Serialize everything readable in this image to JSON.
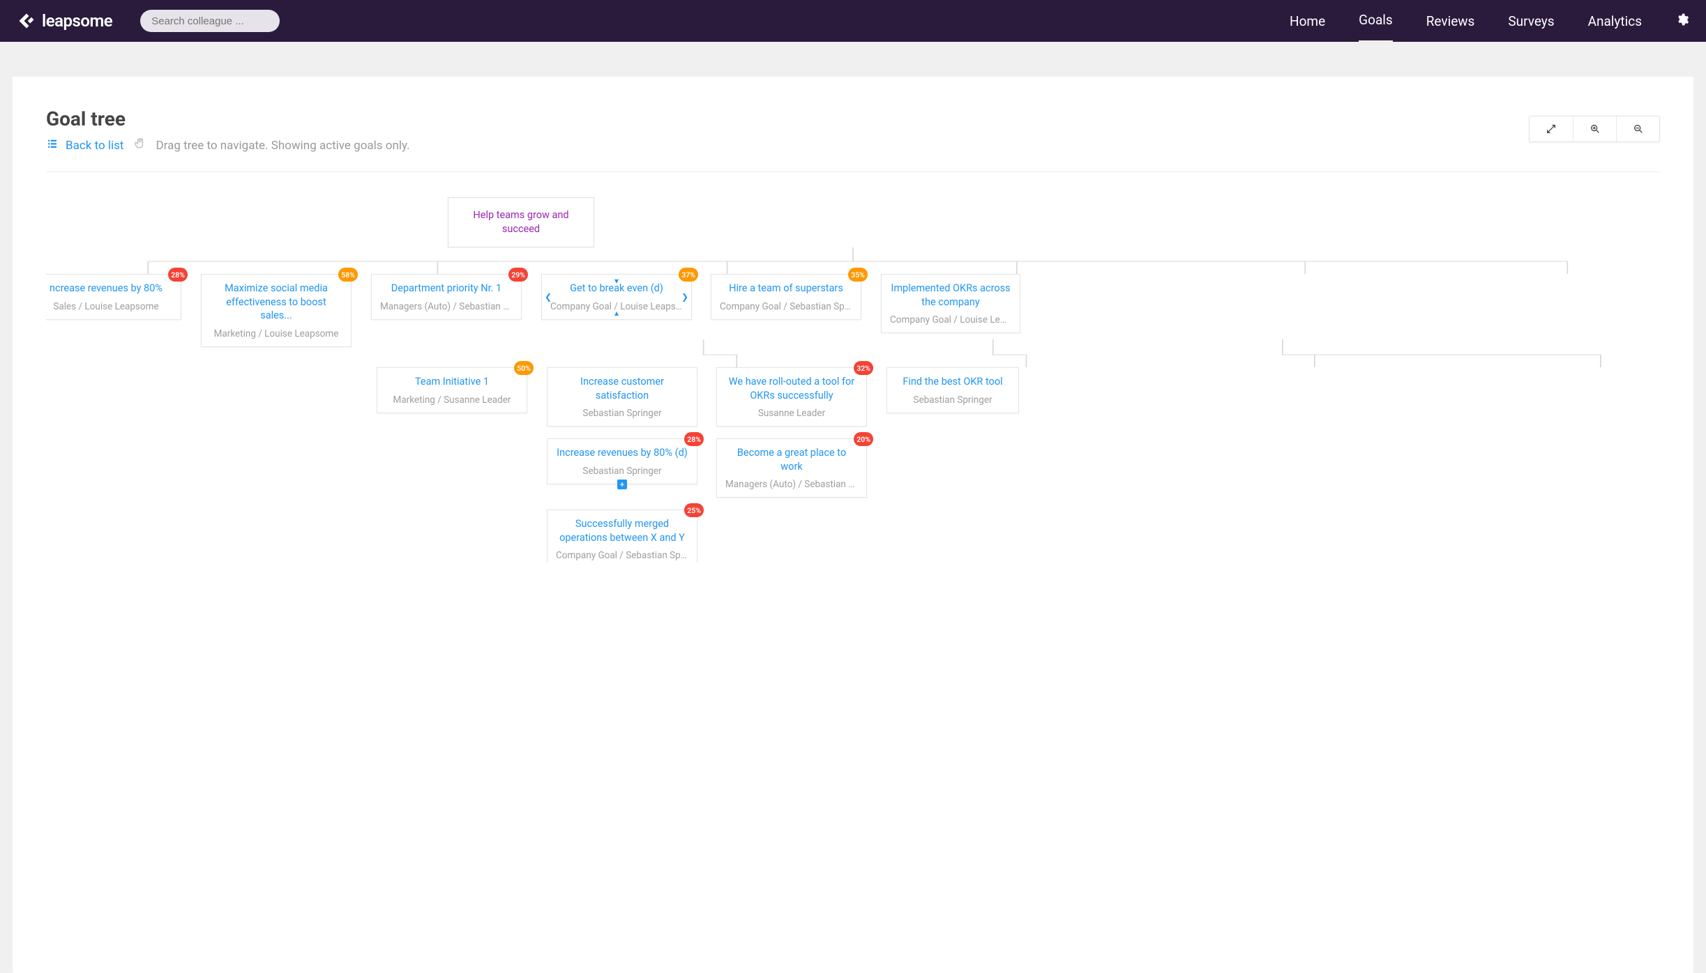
{
  "brand": "leapsome",
  "search": {
    "placeholder": "Search colleague ..."
  },
  "nav": {
    "items": [
      "Home",
      "Goals",
      "Reviews",
      "Surveys",
      "Analytics"
    ],
    "active": 1
  },
  "page": {
    "title": "Goal tree",
    "back_label": "Back to list",
    "hint": "Drag tree to navigate. Showing active goals only."
  },
  "tree": {
    "root": {
      "title": "Help teams grow and succeed"
    },
    "level1": [
      {
        "title": "ncrease revenues by 80%",
        "meta": "Sales / Louise Leapsome",
        "badge": "28%",
        "badge_color": "red"
      },
      {
        "title": "Maximize social media effectiveness to boost sales...",
        "meta": "Marketing / Louise Leapsome",
        "badge": "58%",
        "badge_color": "orange"
      },
      {
        "title": "Department priority Nr. 1",
        "meta": "Managers (Auto) / Sebastian Sprin...",
        "badge": "29%",
        "badge_color": "red"
      },
      {
        "title": "Get to break even (d)",
        "meta": "Company Goal / Louise Leapsome",
        "badge": "37%",
        "badge_color": "orange"
      },
      {
        "title": "Hire a team of superstars",
        "meta": "Company Goal / Sebastian Springer",
        "badge": "35%",
        "badge_color": "orange"
      },
      {
        "title": "Implemented OKRs across the company",
        "meta": "Company Goal / Louise Leapso",
        "badge": "",
        "badge_color": ""
      }
    ],
    "col2_children": [
      {
        "title": "Team Initiative 1",
        "meta": "Marketing / Susanne Leader",
        "badge": "50%",
        "badge_color": "orange"
      }
    ],
    "col3_children": [
      {
        "title": "Increase customer satisfaction",
        "meta": "Sebastian Springer",
        "badge": "",
        "badge_color": ""
      },
      {
        "title": "Increase revenues by 80% (d)",
        "meta": "Sebastian Springer",
        "badge": "28%",
        "badge_color": "red"
      },
      {
        "title": "Successfully merged operations between X and Y",
        "meta": "Company Goal / Sebastian Springer",
        "badge": "25%",
        "badge_color": "red"
      }
    ],
    "col4_children": [
      {
        "title": "We have roll-outed a tool for OKRs successfully",
        "meta": "Susanne Leader",
        "badge": "32%",
        "badge_color": "red"
      },
      {
        "title": "Become a great place to work",
        "meta": "Managers (Auto) / Sebastian Sprin...",
        "badge": "20%",
        "badge_color": "red"
      }
    ],
    "col5_children": [
      {
        "title": "Find the best OKR tool",
        "meta": "Sebastian Springer",
        "badge": "",
        "badge_color": ""
      }
    ]
  }
}
